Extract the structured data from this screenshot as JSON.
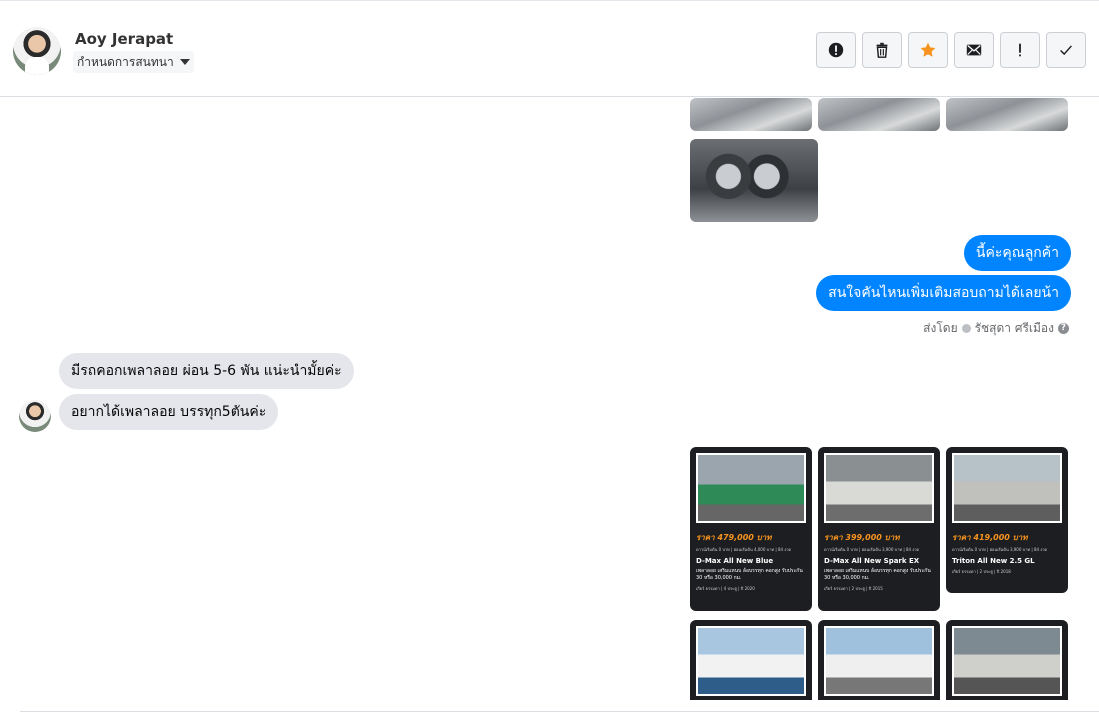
{
  "header": {
    "contact_name": "Aoy Jerapat",
    "assign_label": "กำหนดการสนทนา",
    "toolbar": [
      {
        "name": "alert-circle-icon",
        "label": "!"
      },
      {
        "name": "trash-icon",
        "label": ""
      },
      {
        "name": "star-icon",
        "label": "",
        "color": "#f7931e"
      },
      {
        "name": "mail-icon",
        "label": ""
      },
      {
        "name": "exclamation-icon",
        "label": "!"
      },
      {
        "name": "check-icon",
        "label": ""
      }
    ]
  },
  "messages": {
    "outgoing_1": "นี้ค่ะคุณลูกค้า",
    "outgoing_2": "สนใจคันไหนเพิ่มเติมสอบถามได้เลยน้า",
    "sent_by_prefix": "ส่งโดย",
    "sent_by_name": "รัชสุดา ศรีเมือง",
    "incoming_1": "มีรถคอกเพลาลอย ผ่อน 5-6 พัน แน่ะนำมั้ยค่ะ",
    "incoming_2": "อยากได้เพลาลอย บรรทุก5ตันค่ะ"
  },
  "cards": [
    {
      "price": "ราคา 479,000 บาท",
      "meta": "ดาวน์เริ่มต้น 0 บาท | ผ่อนเริ่มต้น 4,000 บาท | 84 งวด",
      "model": "D-Max All New Blue",
      "desc": "เพลาลอย เสริมแหนบ ล้อบรรทุก คอกสูง รับประกัน 30 หรือ 30,000 กม.",
      "foot": "เกียร์ ธรรมดา | 4 ประตู | ปี 2020"
    },
    {
      "price": "ราคา 399,000 บาท",
      "meta": "ดาวน์เริ่มต้น 0 บาท | ผ่อนเริ่มต้น 3,900 บาท | 84 งวด",
      "model": "D-Max All New Spark EX",
      "desc": "เพลาลอย เสริมแหนบ ล้อบรรทุก คอกสูง รับประกัน 30 หรือ 30,000 กม.",
      "foot": "เกียร์ ธรรมดา | 2 ประตู | ปี 2015"
    },
    {
      "price": "ราคา 419,000 บาท",
      "meta": "ดาวน์เริ่มต้น 0 บาท | ผ่อนเริ่มต้น 3,900 บาท | 84 งวด",
      "model": "Triton All New 2.5 GL",
      "desc": "",
      "foot": "เกียร์ ธรรมดา | 2 ประตู | ปี 2018"
    }
  ]
}
